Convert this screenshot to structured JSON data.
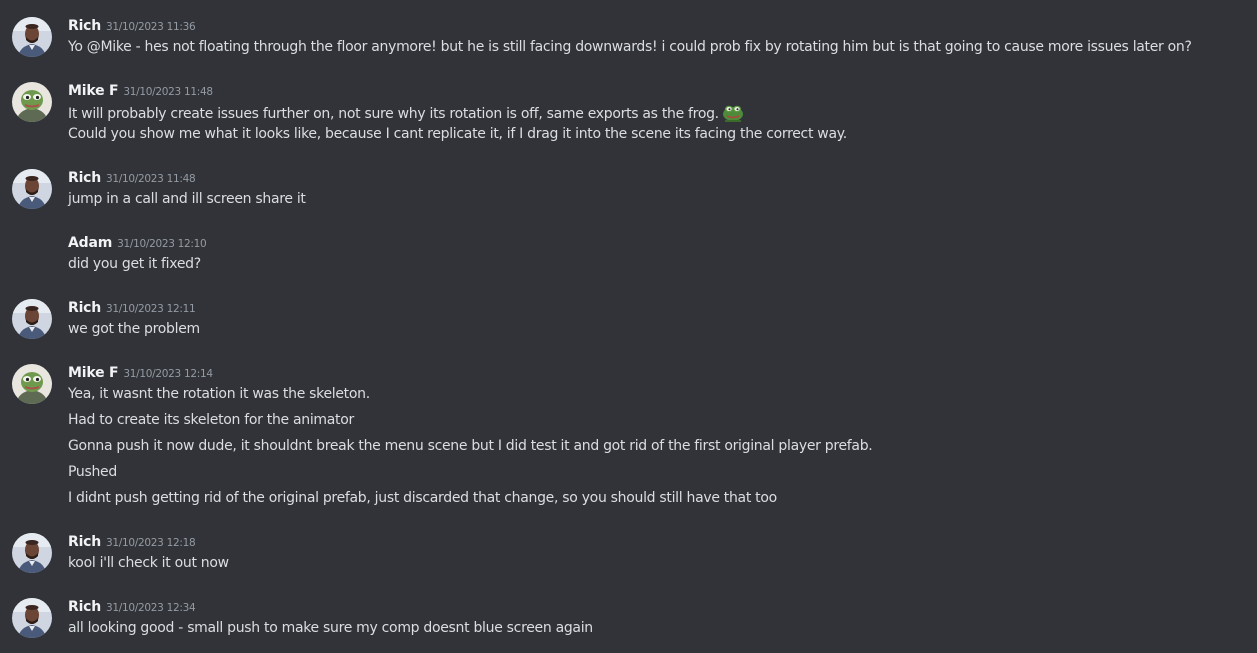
{
  "messages": [
    {
      "author": "Rich",
      "timestamp": "31/10/2023 11:36",
      "lines": [
        "Yo @Mike - hes not floating through the floor anymore! but he is still facing downwards! i could prob fix by rotating him but is that going to cause more issues later on?"
      ]
    },
    {
      "author": "Mike F",
      "timestamp": "31/10/2023 11:48",
      "lines": [
        "It will probably create issues further on, not sure why its rotation is off, same exports as the frog.",
        "Could you show me what it looks like, because I cant replicate it, if I drag it into the scene its facing the correct way."
      ],
      "emoji": "frog-emoji"
    },
    {
      "author": "Rich",
      "timestamp": "31/10/2023 11:48",
      "lines": [
        "jump in a call and ill screen share it"
      ]
    },
    {
      "author": "Adam",
      "timestamp": "31/10/2023 12:10",
      "lines": [
        "did you get it fixed?"
      ]
    },
    {
      "author": "Rich",
      "timestamp": "31/10/2023 12:11",
      "lines": [
        "we got the problem"
      ]
    },
    {
      "author": "Mike F",
      "timestamp": "31/10/2023 12:14",
      "lines": [
        "Yea, it wasnt the rotation it was the skeleton.",
        "Had to create its skeleton for the animator",
        "Gonna push it now dude, it shouldnt break the menu scene but I did test it and got rid of the first original player prefab.",
        "Pushed",
        "I didnt push getting rid of the original prefab, just discarded that change, so you should still have that too"
      ]
    },
    {
      "author": "Rich",
      "timestamp": "31/10/2023 12:18",
      "lines": [
        "kool i'll check it out now"
      ]
    },
    {
      "author": "Rich",
      "timestamp": "31/10/2023 12:34",
      "lines": [
        "all looking good - small push to make sure my comp doesnt blue screen again"
      ]
    }
  ]
}
